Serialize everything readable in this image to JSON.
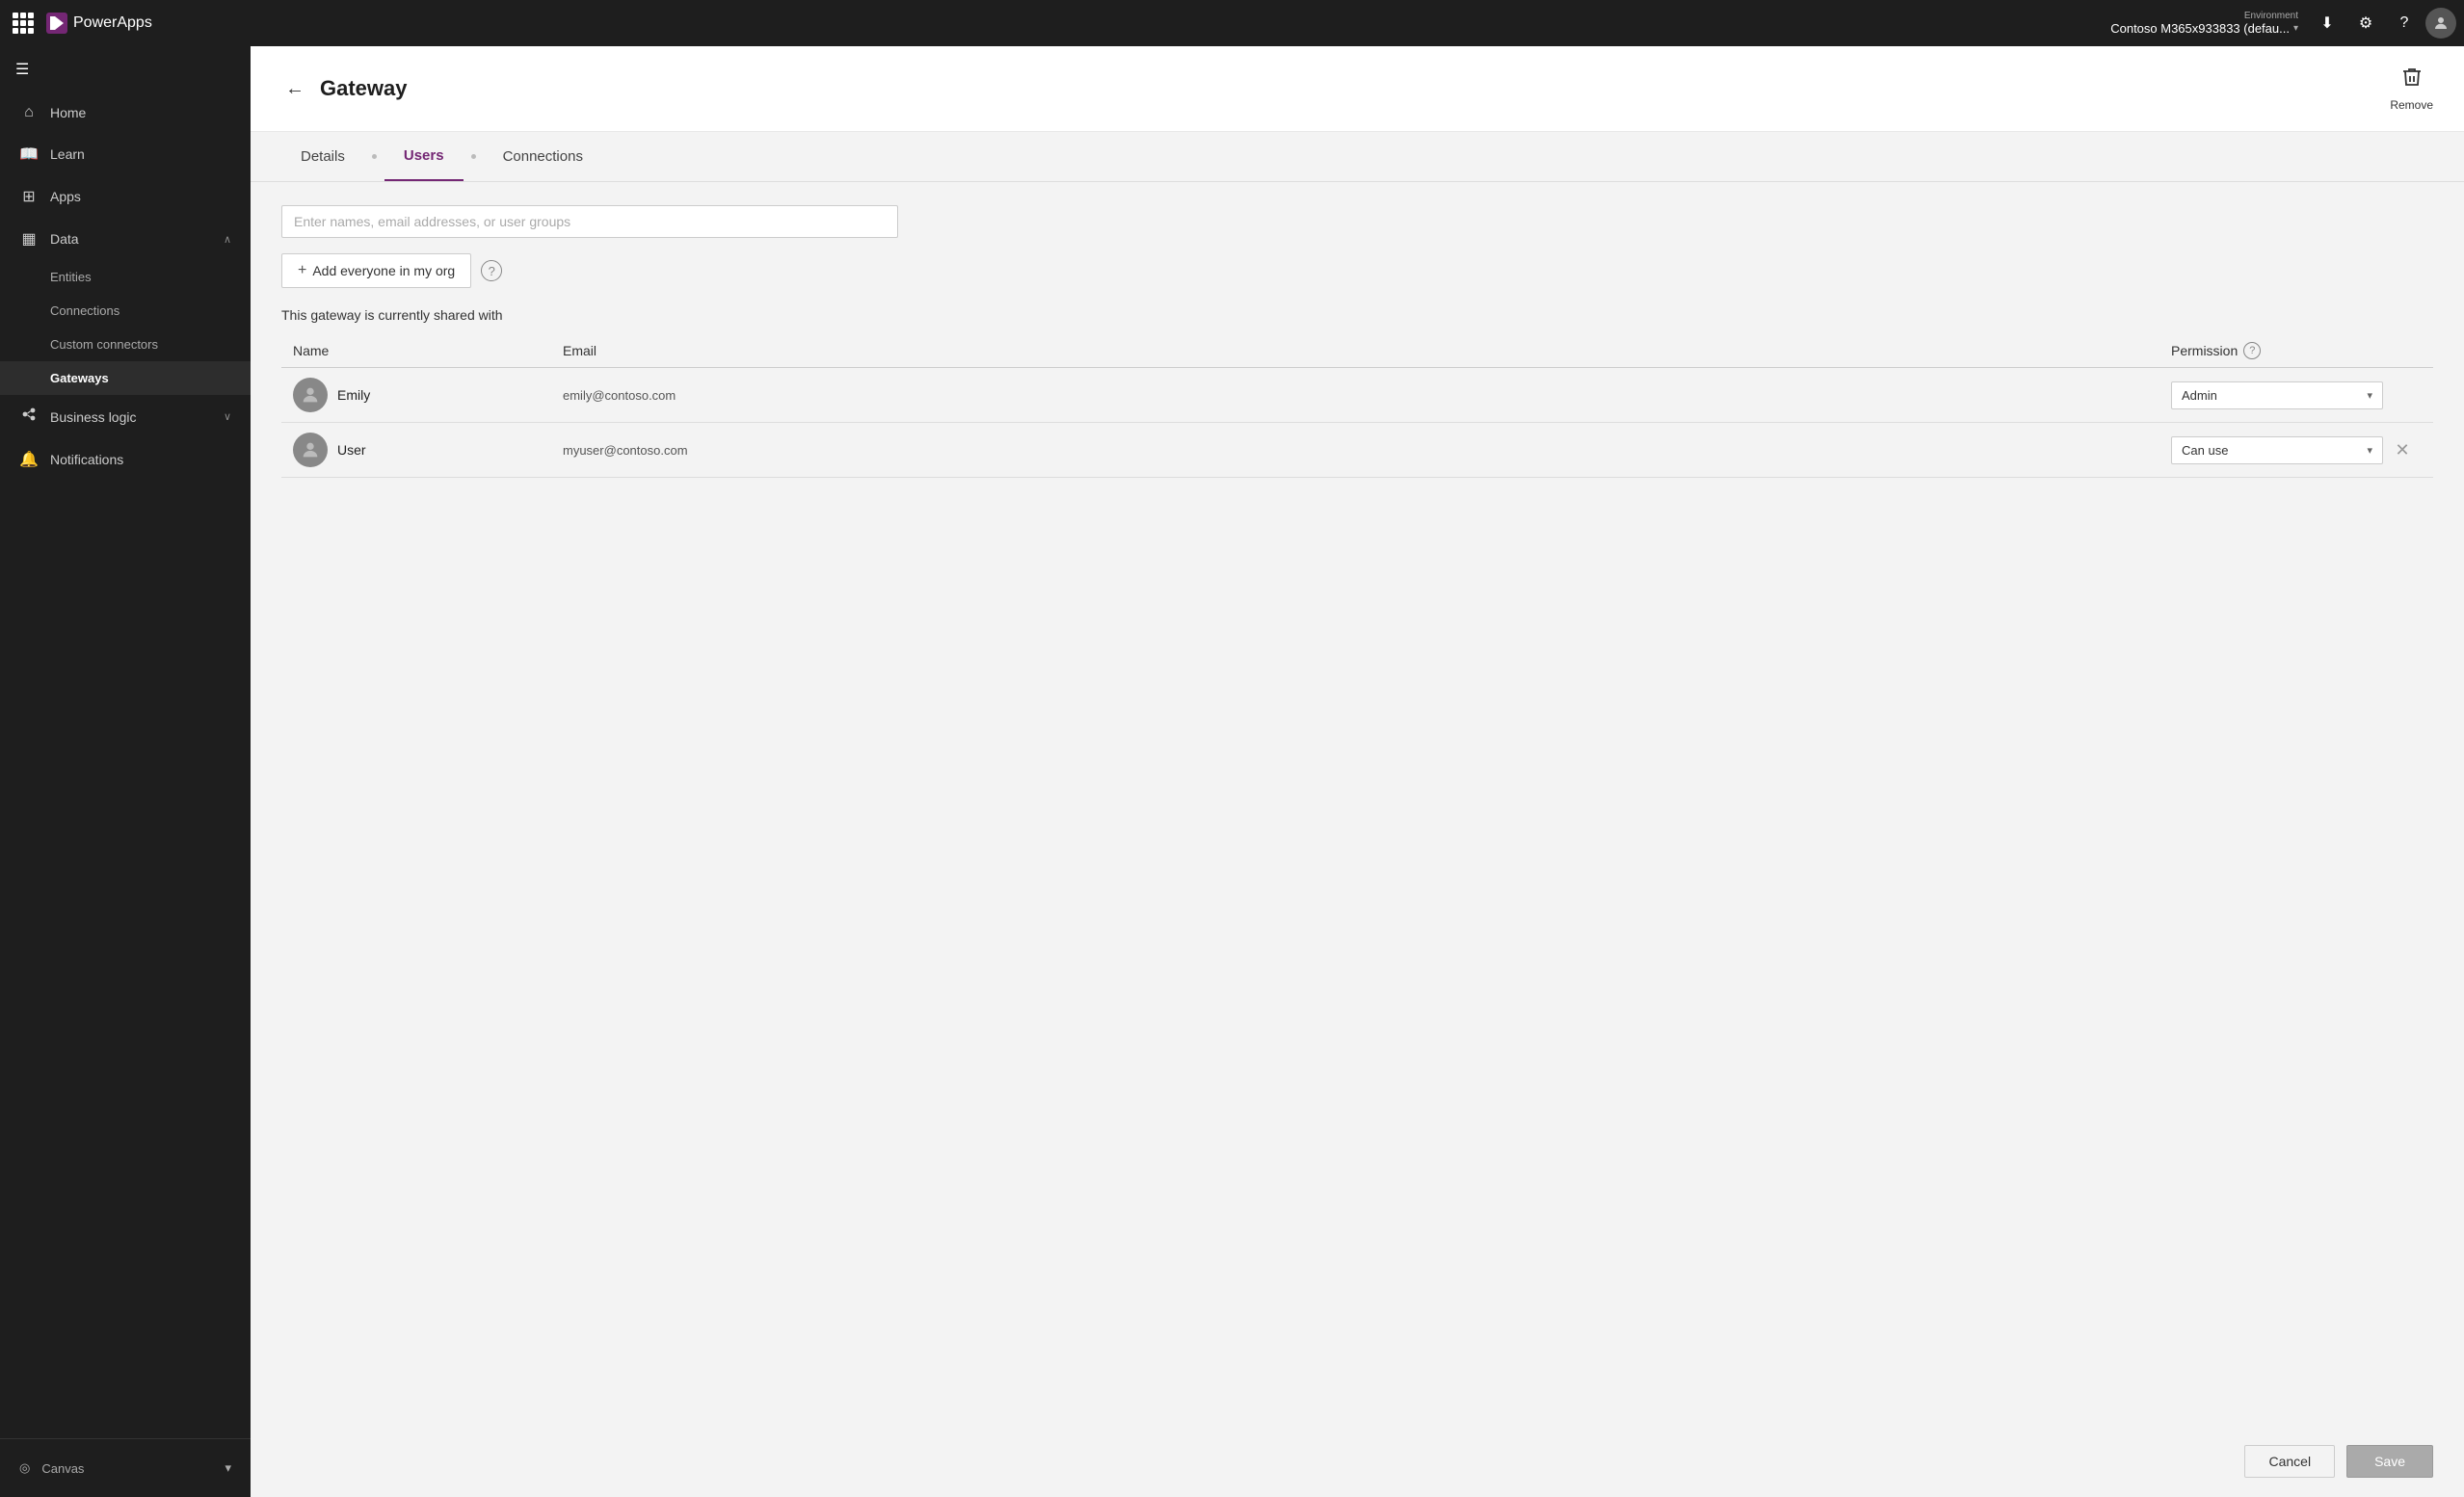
{
  "topnav": {
    "app_name": "PowerApps",
    "environment_label": "Environment",
    "environment_name": "Contoso M365x933833 (defau...",
    "download_icon": "⬇",
    "settings_icon": "⚙",
    "help_icon": "?",
    "avatar_icon": "👤"
  },
  "sidebar": {
    "hamburger_icon": "☰",
    "items": [
      {
        "id": "home",
        "label": "Home",
        "icon": "⌂"
      },
      {
        "id": "learn",
        "label": "Learn",
        "icon": "📖"
      },
      {
        "id": "apps",
        "label": "Apps",
        "icon": "⊞"
      },
      {
        "id": "data",
        "label": "Data",
        "icon": "▦",
        "has_chevron": true,
        "expanded": true
      },
      {
        "id": "entities",
        "label": "Entities",
        "sub": true
      },
      {
        "id": "connections",
        "label": "Connections",
        "sub": true
      },
      {
        "id": "custom_connectors",
        "label": "Custom connectors",
        "sub": true
      },
      {
        "id": "gateways",
        "label": "Gateways",
        "sub": true,
        "active": true
      },
      {
        "id": "business_logic",
        "label": "Business logic",
        "icon": "⚙",
        "has_chevron": true
      },
      {
        "id": "notifications",
        "label": "Notifications",
        "icon": "🔔"
      }
    ],
    "bottom": {
      "canvas_label": "Canvas",
      "canvas_icon": "◎",
      "canvas_chevron": "▾"
    }
  },
  "page": {
    "title": "Gateway",
    "back_label": "←",
    "remove_label": "Remove"
  },
  "tabs": [
    {
      "id": "details",
      "label": "Details",
      "active": false
    },
    {
      "id": "users",
      "label": "Users",
      "active": true
    },
    {
      "id": "connections",
      "label": "Connections",
      "active": false
    }
  ],
  "users_panel": {
    "search_placeholder": "Enter names, email addresses, or user groups",
    "add_everyone_label": "Add everyone in my org",
    "help_icon": "?",
    "shared_with_text": "This gateway is currently shared with",
    "table_columns": {
      "name": "Name",
      "email": "Email",
      "permission": "Permission"
    },
    "users": [
      {
        "id": "emily",
        "name": "Emily",
        "email": "emily@contoso.com",
        "permission": "Admin",
        "can_remove": false
      },
      {
        "id": "user",
        "name": "User",
        "email": "myuser@contoso.com",
        "permission": "Can use",
        "can_remove": true
      }
    ],
    "cancel_label": "Cancel",
    "save_label": "Save"
  }
}
